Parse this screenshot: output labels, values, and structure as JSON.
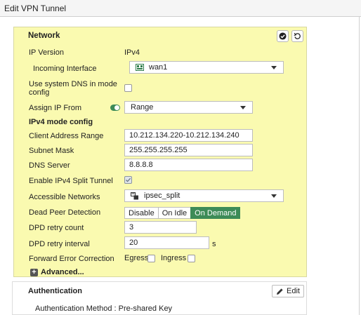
{
  "window": {
    "title": "Edit VPN Tunnel"
  },
  "network": {
    "title": "Network",
    "ip_version_label": "IP Version",
    "ip_version_value": "IPv4",
    "incoming_interface_label": "Incoming Interface",
    "incoming_interface_value": "wan1",
    "system_dns_label_line1": "Use system DNS in mode",
    "system_dns_label_line2": "config",
    "system_dns_checked": false,
    "assign_ip_label": "Assign IP From",
    "assign_ip_value": "Range",
    "mode_config_heading": "IPv4 mode config",
    "client_range_label": "Client Address Range",
    "client_range_value": "10.212.134.220-10.212.134.240",
    "subnet_mask_label": "Subnet Mask",
    "subnet_mask_value": "255.255.255.255",
    "dns_server_label": "DNS Server",
    "dns_server_value": "8.8.8.8",
    "split_tunnel_label": "Enable IPv4 Split Tunnel",
    "split_tunnel_checked": true,
    "accessible_networks_label": "Accessible Networks",
    "accessible_networks_value": "ipsec_split",
    "dpd_label": "Dead Peer Detection",
    "dpd_options": [
      "Disable",
      "On Idle",
      "On Demand"
    ],
    "dpd_selected": "On Demand",
    "dpd_retry_count_label": "DPD retry count",
    "dpd_retry_count_value": "3",
    "dpd_retry_interval_label": "DPD retry interval",
    "dpd_retry_interval_value": "20",
    "dpd_retry_interval_unit": "s",
    "fec_label": "Forward Error Correction",
    "fec_egress_label": "Egress",
    "fec_ingress_label": "Ingress",
    "advanced_label": "Advanced..."
  },
  "authentication": {
    "title": "Authentication",
    "edit_label": "Edit",
    "method_text": "Authentication Method : Pre-shared Key"
  },
  "colors": {
    "panel_background": "#fafab0",
    "accent_green": "#3d8b57"
  },
  "icons": [
    "checkmark-icon",
    "undo-icon",
    "interface-icon",
    "address-group-icon",
    "plus-icon",
    "pencil-icon"
  ]
}
